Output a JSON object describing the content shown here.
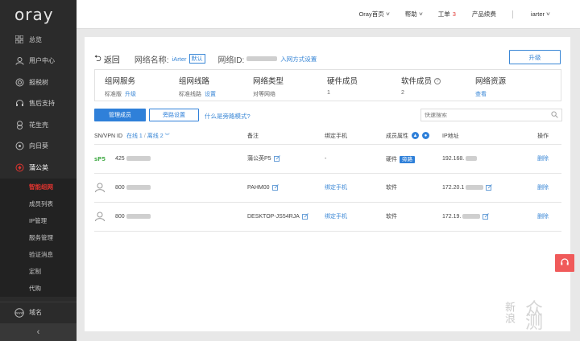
{
  "app": {
    "logo": "oray"
  },
  "sidebar": {
    "items": [
      {
        "label": "总览",
        "icon": "grid-icon"
      },
      {
        "label": "用户中心",
        "icon": "user-icon"
      },
      {
        "label": "报税树",
        "icon": "target-icon"
      },
      {
        "label": "售后支持",
        "icon": "headset-icon"
      },
      {
        "label": "花生壳",
        "icon": "peanut-icon"
      },
      {
        "label": "向日葵",
        "icon": "sunflower-icon"
      },
      {
        "label": "蒲公英",
        "icon": "dandelion-icon"
      }
    ],
    "sub_items": [
      {
        "label": "智能组网",
        "active": true
      },
      {
        "label": "成员列表",
        "active": false
      },
      {
        "label": "IP管理",
        "active": false
      },
      {
        "label": "服务管理",
        "active": false
      },
      {
        "label": "验证消息",
        "active": false
      },
      {
        "label": "定制",
        "active": false
      },
      {
        "label": "代购",
        "active": false
      }
    ],
    "domain": {
      "label": "域名",
      "icon": "www-icon"
    }
  },
  "topbar": {
    "home": "Oray首页",
    "help": "帮助",
    "tickets": "工单",
    "tickets_count": "3",
    "renewal": "产品续费",
    "user": "iarter"
  },
  "network": {
    "back": "返回",
    "name_label": "网络名称:",
    "name_value": "iArter",
    "name_tag": "默认",
    "id_label": "网络ID:",
    "join_method": "入网方式设置",
    "upgrade": "升级",
    "info": [
      {
        "title": "组网服务",
        "value": "标准版",
        "link": "升级"
      },
      {
        "title": "组网线路",
        "value": "标准线路",
        "link": "设置"
      },
      {
        "title": "网络类型",
        "value": "对等网络",
        "link": ""
      },
      {
        "title": "硬件成员",
        "value": "1",
        "link": ""
      },
      {
        "title": "软件成员",
        "value": "2",
        "link": ""
      },
      {
        "title": "网络资源",
        "value": "",
        "link": "查看"
      }
    ]
  },
  "actions": {
    "manage_members": "管理成员",
    "bypass_settings": "旁路设置",
    "bypass_help": "什么是旁路模式?",
    "search_placeholder": "快速搜索"
  },
  "table": {
    "headers": {
      "sn": "SN/VPN ID",
      "online": "在线 1",
      "offline": "离线 2",
      "note": "备注",
      "phone": "绑定手机",
      "attr": "成员属性",
      "ip": "IP地址",
      "ops": "操作"
    },
    "rows": [
      {
        "id": "425",
        "note": "蒲公英P5",
        "phone": "-",
        "attr": "硬件",
        "attr_badge": "旁路",
        "ip": "192.168.",
        "op": "删除",
        "kind": "hardware"
      },
      {
        "id": "800",
        "note": "PAHM00",
        "phone": "绑定手机",
        "attr": "软件",
        "attr_badge": "",
        "ip": "172.20.1",
        "op": "删除",
        "kind": "software"
      },
      {
        "id": "800",
        "note": "DESKTOP-JS54RJA",
        "phone": "绑定手机",
        "attr": "软件",
        "attr_badge": "",
        "ip": "172.19.",
        "op": "删除",
        "kind": "software"
      }
    ]
  },
  "watermark": {
    "text1": "新浪",
    "text2": "众测"
  },
  "colors": {
    "accent": "#2f80d9",
    "sidebar_bg": "#2b2b2b",
    "active_red": "#e0342f"
  }
}
